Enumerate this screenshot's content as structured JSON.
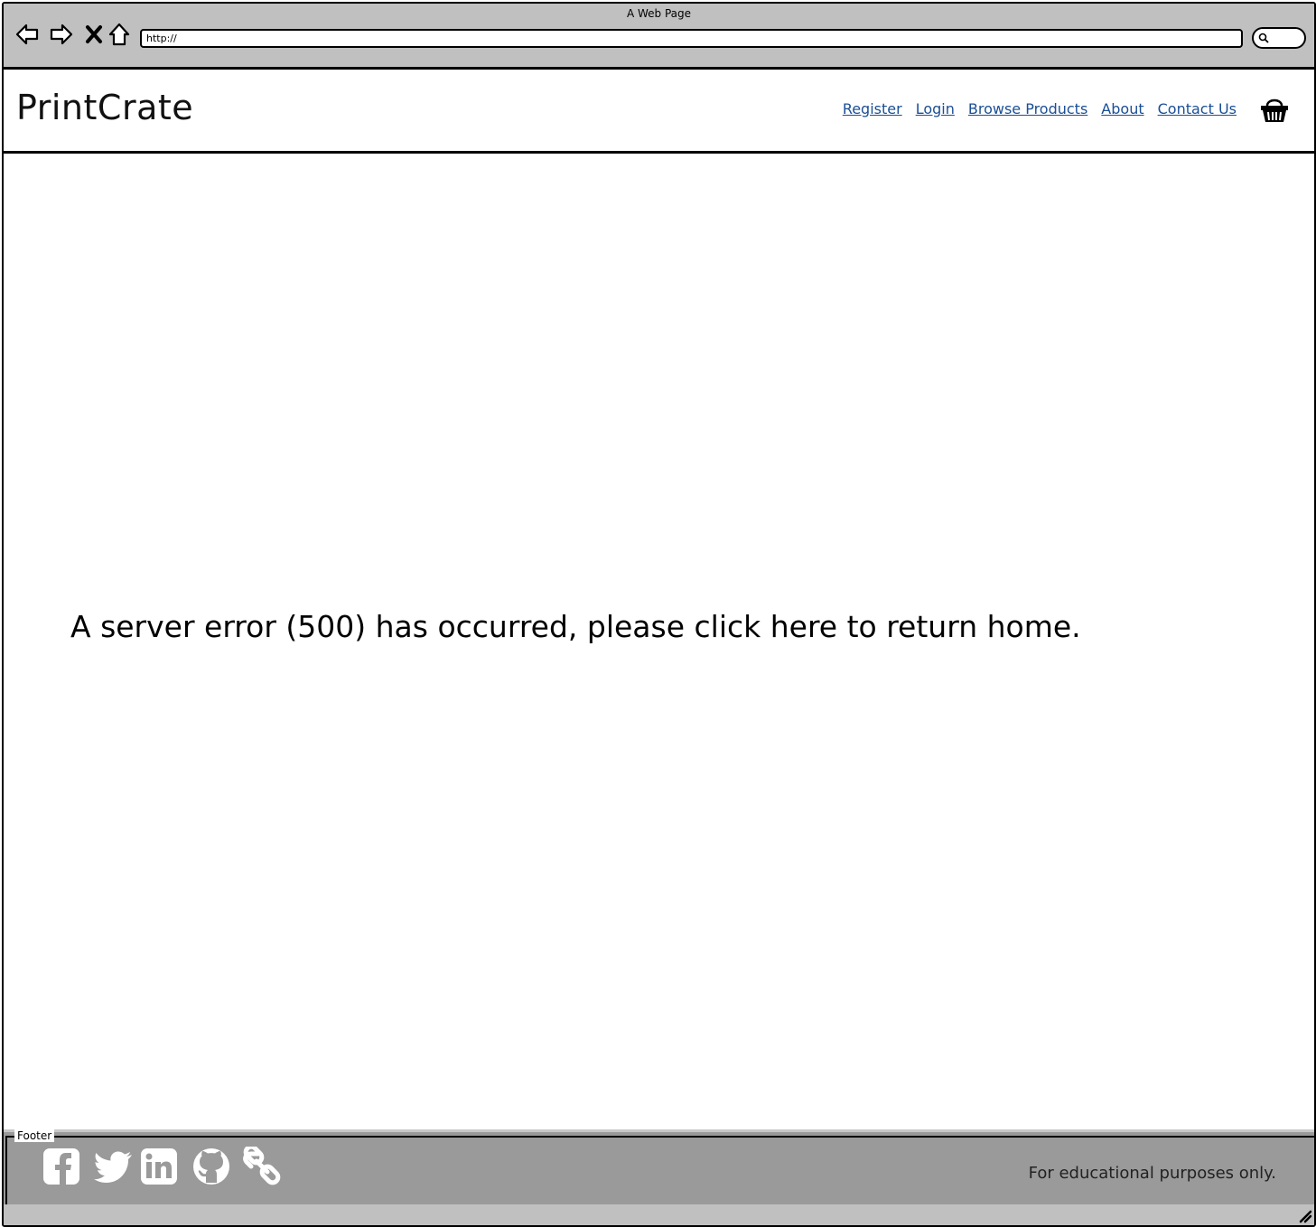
{
  "window": {
    "title": "A Web Page",
    "url": "http://"
  },
  "icons": {
    "back": "back-arrow-icon",
    "forward": "forward-arrow-icon",
    "stop": "close-x-icon",
    "home": "home-icon",
    "search": "search-icon",
    "cart": "shopping-basket-icon",
    "facebook": "facebook-icon",
    "twitter": "twitter-icon",
    "linkedin": "linkedin-icon",
    "github": "github-icon",
    "link": "link-icon",
    "resize": "resize-grip-icon"
  },
  "header": {
    "brand": "PrintCrate",
    "nav": {
      "register": "Register",
      "login": "Login",
      "browse": "Browse Products",
      "about": "About",
      "contact": "Contact Us"
    }
  },
  "main": {
    "error_message": "A server error (500) has occurred, please click here to return home."
  },
  "footer": {
    "legend": "Footer",
    "note": "For educational purposes only."
  },
  "colors": {
    "chrome": "#c0c0c0",
    "link": "#1a4f94",
    "footer_bg": "#9a9a9a"
  }
}
